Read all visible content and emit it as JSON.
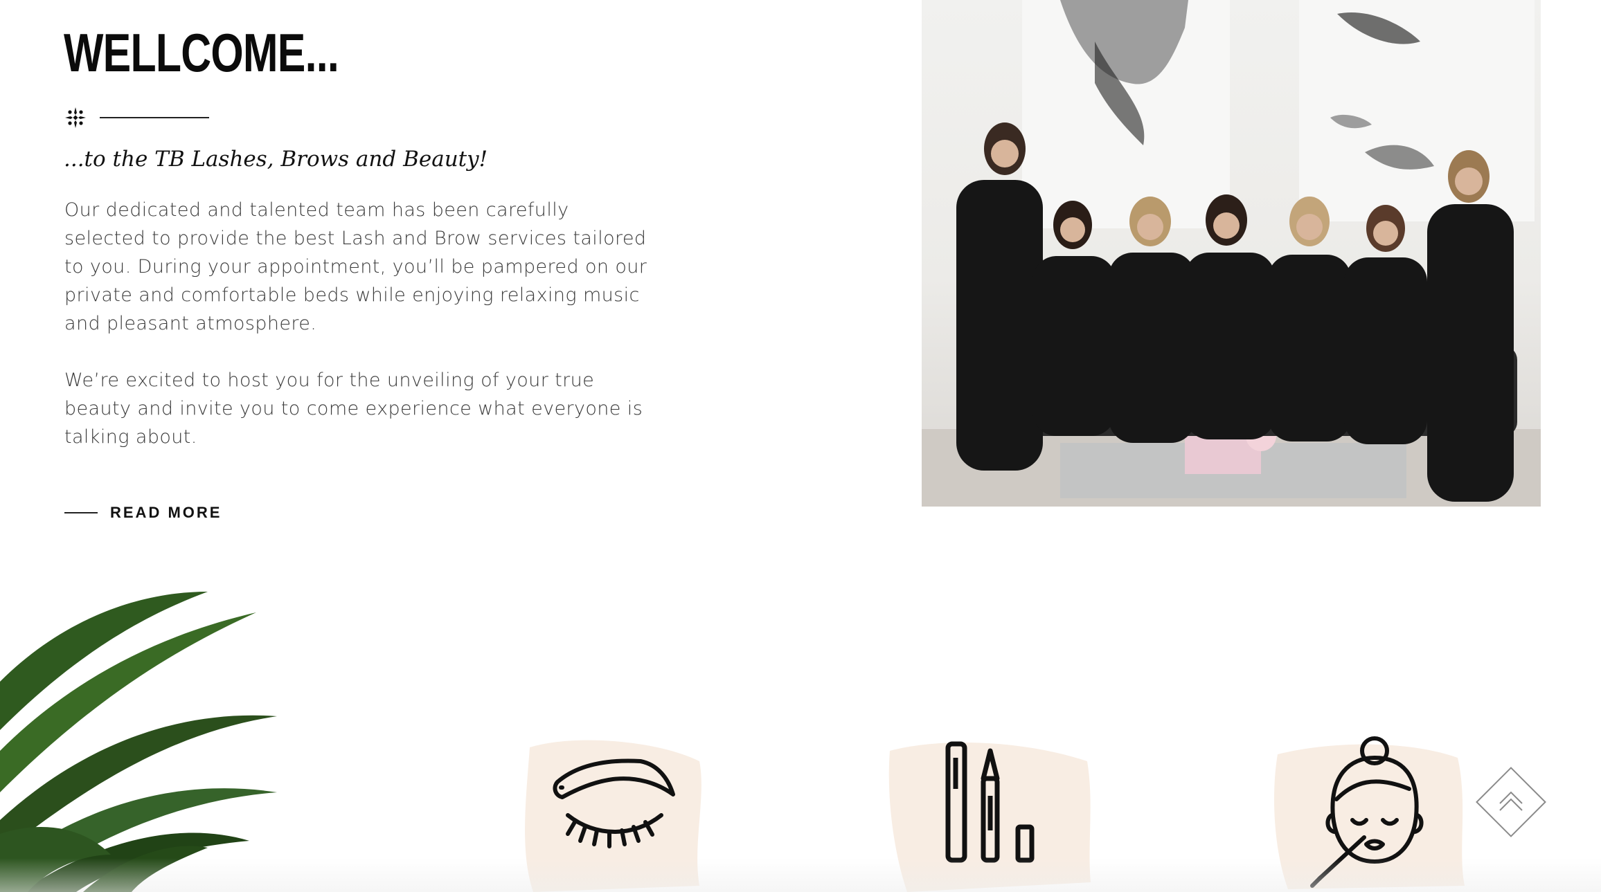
{
  "welcome": {
    "heading": "WELLCOME...",
    "subtitle": "...to the TB Lashes, Brows and Beauty!",
    "paragraph_1": "Our dedicated and talented team has been carefully selected to provide the best Lash and Brow services tailored to you. During your appointment, you’ll be pampered on our private and comfortable beds while enjoying relaxing music and pleasant atmosphere.",
    "paragraph_2": "We’re excited to host you for the unveiling of your true beauty and invite you to come experience what everyone is talking about.",
    "read_more_label": "READ MORE"
  },
  "colors": {
    "text_dark": "#0b0b0b",
    "body_text": "#3a3a3a",
    "brush_beige": "#f8ede3",
    "palm_green": "#2f5a1f"
  },
  "icons": {
    "ornament": "ornament-star-icon",
    "brow": "eyebrow-lash-icon",
    "pencils": "makeup-pencil-icon",
    "face": "face-makeup-icon",
    "back_to_top": "chevron-up-double-icon"
  }
}
